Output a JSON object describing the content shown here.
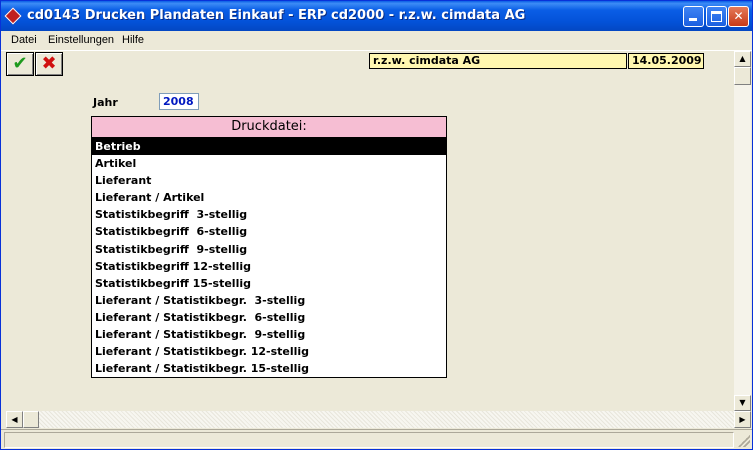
{
  "window": {
    "title": "cd0143 Drucken Plandaten Einkauf - ERP cd2000 - r.z.w. cimdata AG"
  },
  "menu": {
    "items": [
      "Datei",
      "Einstellungen",
      "Hilfe"
    ]
  },
  "toolbar": {
    "ok_icon": "✔",
    "cancel_icon": "✖"
  },
  "header_info": {
    "company": "r.z.w. cimdata AG",
    "date": "14.05.2009"
  },
  "form": {
    "year_label": "Jahr",
    "year_value": "2008"
  },
  "print_file_list": {
    "header": "Druckdatei:",
    "selected_index": 0,
    "items": [
      "Betrieb",
      "Artikel",
      "Lieferant",
      "Lieferant / Artikel",
      "Statistikbegriff  3-stellig",
      "Statistikbegriff  6-stellig",
      "Statistikbegriff  9-stellig",
      "Statistikbegriff 12-stellig",
      "Statistikbegriff 15-stellig",
      "Lieferant / Statistikbegr.  3-stellig",
      "Lieferant / Statistikbegr.  6-stellig",
      "Lieferant / Statistikbegr.  9-stellig",
      "Lieferant / Statistikbegr. 12-stellig",
      "Lieferant / Statistikbegr. 15-stellig"
    ]
  },
  "colors": {
    "title_bar": "#0a5ee6",
    "info_box": "#fff7b0",
    "list_header": "#f6bed3",
    "selected_row": "#000000"
  }
}
